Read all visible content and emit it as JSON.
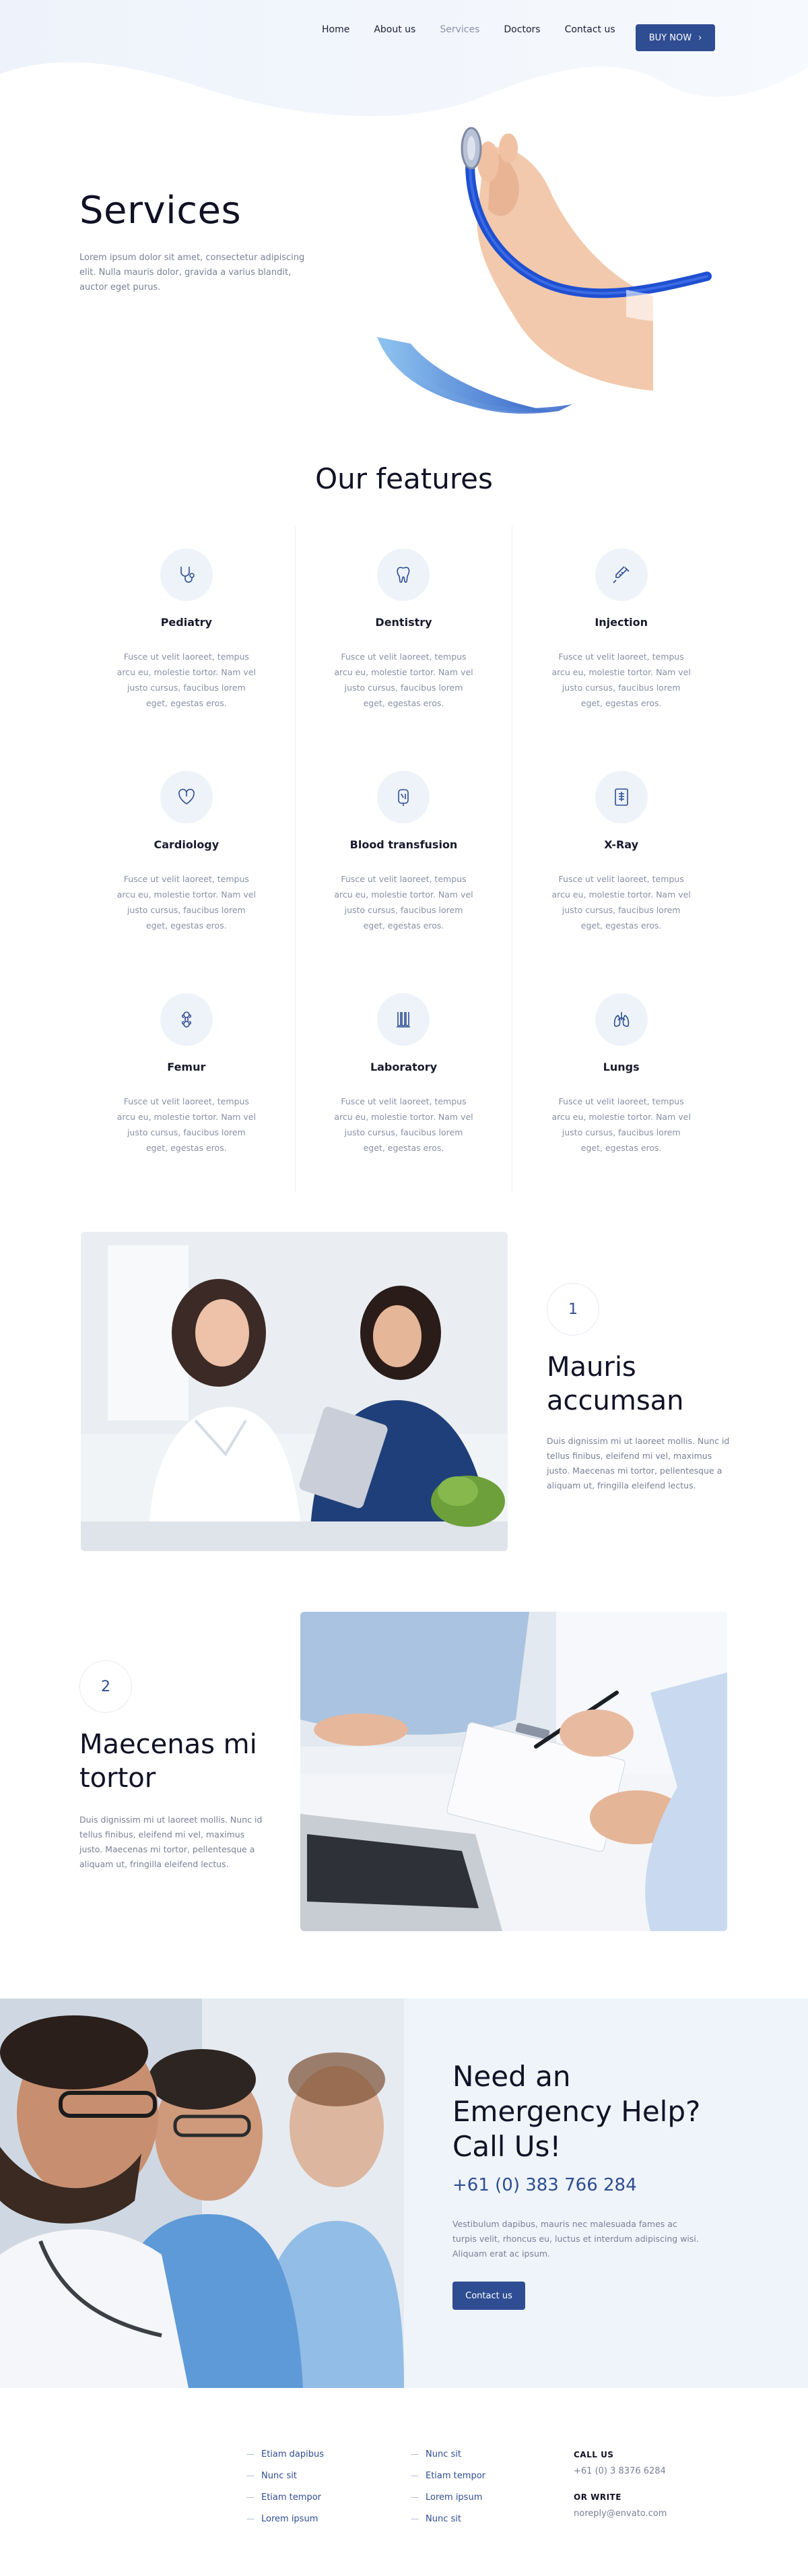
{
  "nav": {
    "items": [
      {
        "label": "Home",
        "active": false
      },
      {
        "label": "About us",
        "active": false
      },
      {
        "label": "Services",
        "active": true
      },
      {
        "label": "Doctors",
        "active": false
      },
      {
        "label": "Contact us",
        "active": false
      }
    ],
    "buy_label": "BUY NOW"
  },
  "hero": {
    "title": "Services",
    "text": "Lorem ipsum dolor sit amet, consectetur adipiscing elit. Nulla mauris dolor, gravida a varius blandit, auctor eget purus."
  },
  "features": {
    "title": "Our features",
    "items": [
      {
        "name": "Pediatry",
        "icon": "stethoscope-icon",
        "text": "Fusce ut velit laoreet, tempus arcu eu, molestie tortor. Nam vel justo cursus, faucibus lorem eget, egestas eros."
      },
      {
        "name": "Dentistry",
        "icon": "tooth-icon",
        "text": "Fusce ut velit laoreet, tempus arcu eu, molestie tortor. Nam vel justo cursus, faucibus lorem eget, egestas eros."
      },
      {
        "name": "Injection",
        "icon": "syringe-icon",
        "text": "Fusce ut velit laoreet, tempus arcu eu, molestie tortor. Nam vel justo cursus, faucibus lorem eget, egestas eros."
      },
      {
        "name": "Cardiology",
        "icon": "heart-icon",
        "text": "Fusce ut velit laoreet, tempus arcu eu, molestie tortor. Nam vel justo cursus, faucibus lorem eget, egestas eros."
      },
      {
        "name": "Blood transfusion",
        "icon": "blood-bag-icon",
        "text": "Fusce ut velit laoreet, tempus arcu eu, molestie tortor. Nam vel justo cursus, faucibus lorem eget, egestas eros."
      },
      {
        "name": "X-Ray",
        "icon": "xray-icon",
        "text": "Fusce ut velit laoreet, tempus arcu eu, molestie tortor. Nam vel justo cursus, faucibus lorem eget, egestas eros."
      },
      {
        "name": "Femur",
        "icon": "bone-icon",
        "text": "Fusce ut velit laoreet, tempus arcu eu, molestie tortor. Nam vel justo cursus, faucibus lorem eget, egestas eros."
      },
      {
        "name": "Laboratory",
        "icon": "flask-icon",
        "text": "Fusce ut velit laoreet, tempus arcu eu, molestie tortor. Nam vel justo cursus, faucibus lorem eget, egestas eros."
      },
      {
        "name": "Lungs",
        "icon": "lungs-icon",
        "text": "Fusce ut velit laoreet, tempus arcu eu, molestie tortor. Nam vel justo cursus, faucibus lorem eget, egestas eros."
      }
    ]
  },
  "steps": [
    {
      "number": "1",
      "title": "Mauris accumsan",
      "text": "Duis dignissim mi ut laoreet mollis. Nunc id tellus finibus, eleifend mi vel, maximus justo. Maecenas mi tortor, pellentesque a aliquam ut, fringilla eleifend lectus."
    },
    {
      "number": "2",
      "title": "Maecenas mi tortor",
      "text": "Duis dignissim mi ut laoreet mollis. Nunc id tellus finibus, eleifend mi vel, maximus justo. Maecenas mi tortor, pellentesque a aliquam ut, fringilla eleifend lectus."
    }
  ],
  "emergency": {
    "title": "Need an Emergency Help? Call Us!",
    "phone": "+61 (0) 383 766 284",
    "text": "Vestibulum dapibus, mauris nec malesuada fames ac turpis velit, rhoncus eu, luctus et interdum adipiscing wisi. Aliquam erat ac ipsum.",
    "button_label": "Contact us"
  },
  "footer": {
    "col1": [
      "Etiam dapibus",
      "Nunc sit",
      "Etiam tempor",
      "Lorem ipsum"
    ],
    "col2": [
      "Nunc sit",
      "Etiam tempor",
      "Lorem ipsum",
      "Nunc sit"
    ],
    "call_heading": "CALL US",
    "call_value": "+61 (0) 3 8376 6284",
    "write_heading": "OR WRITE",
    "write_value": "noreply@envato.com"
  },
  "colors": {
    "accent": "#2f4d92",
    "icon_bg": "#edf3f9",
    "panel_bg": "#eef4f9"
  }
}
